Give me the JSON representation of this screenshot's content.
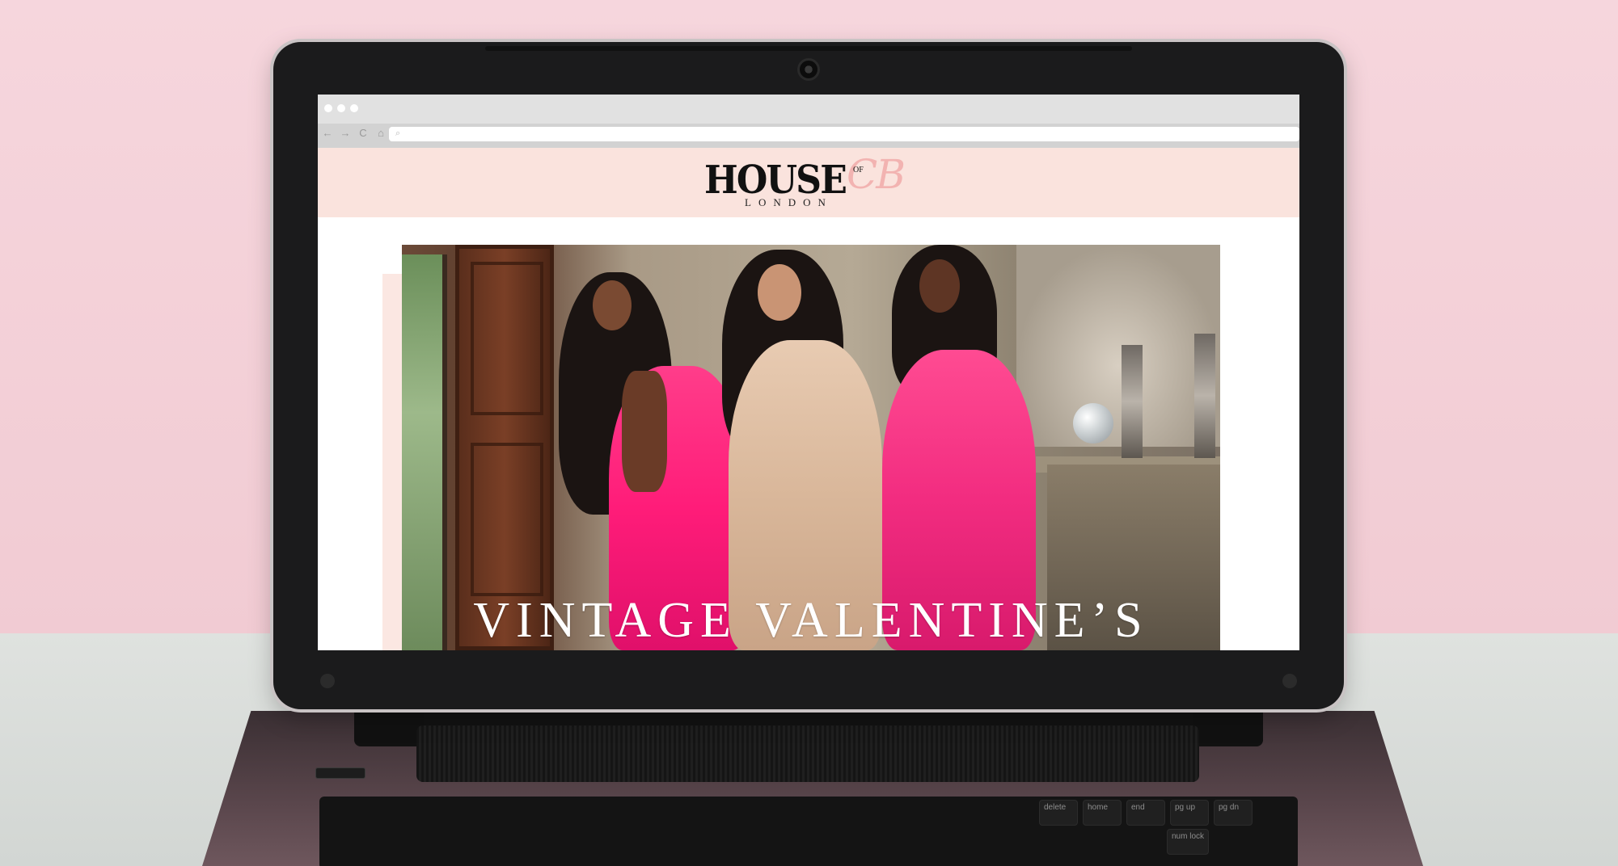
{
  "browser": {
    "window_controls": [
      "dot",
      "dot",
      "dot"
    ],
    "nav_icons": [
      "←",
      "→",
      "C",
      "⌂"
    ],
    "url": ""
  },
  "site": {
    "logo": {
      "word_house": "HOUSE",
      "word_of": "OF",
      "word_cb": "CB",
      "word_london": "LONDON"
    },
    "header_bg": "#fae3dd",
    "accent": "#f2b3b1"
  },
  "hero": {
    "title": "VINTAGE VALENTINE’S"
  },
  "keyboard": {
    "keys": [
      "delete",
      "home",
      "end",
      "pg up",
      "pg dn",
      "num lock"
    ]
  }
}
